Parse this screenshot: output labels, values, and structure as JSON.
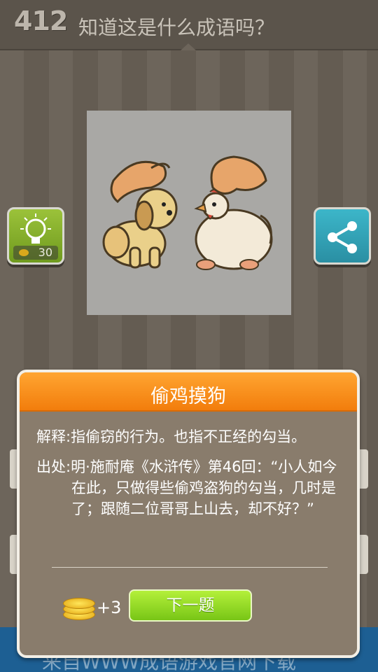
{
  "header": {
    "level": "412",
    "question": "知道这是什么成语吗？"
  },
  "hint": {
    "cost": "30"
  },
  "dialog": {
    "title": "偷鸡摸狗",
    "meaning": "解释:指偷窃的行为。也指不正经的勾当。",
    "source": "出处:明·施耐庵《水浒传》第46回：“小人如今在此，只做得些偷鸡盗狗的勾当，几时是了；跟随二位哥哥上山去，却不好？”",
    "reward": "+3",
    "next_label": "下一题"
  },
  "footer": {
    "text": "来自WWW成语游戏官网下载"
  },
  "colors": {
    "title_bar": "#f58a14",
    "next_button": "#8fd622",
    "hint_button": "#8ab62f",
    "share_button": "#33a9bd"
  }
}
